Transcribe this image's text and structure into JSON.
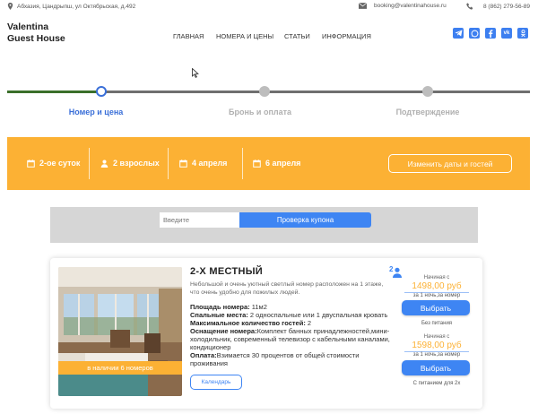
{
  "topbar": {
    "address": "Абхазия, Цандрыпш, ул Октябрьская, д.492",
    "email": "booking@valentinahouse.ru",
    "phone": "8 (862) 279-56-89"
  },
  "brand": {
    "line1": "Valentina",
    "line2": "Guest House"
  },
  "nav": [
    {
      "label": "ГЛАВНАЯ"
    },
    {
      "label": "НОМЕРА И ЦЕНЫ"
    },
    {
      "label": "СТАТЬИ"
    },
    {
      "label": "ИНФОРМАЦИЯ"
    }
  ],
  "socials": [
    {
      "icon": "telegram-icon"
    },
    {
      "icon": "whatsapp-icon"
    },
    {
      "icon": "facebook-icon"
    },
    {
      "icon": "vk-icon"
    },
    {
      "icon": "odnoklassniki-icon"
    }
  ],
  "stepper": {
    "steps": [
      {
        "label": "Номер и цена",
        "state": "active"
      },
      {
        "label": "Бронь и оплата",
        "state": "pending"
      },
      {
        "label": "Подтверждение",
        "state": "pending"
      }
    ],
    "colors": {
      "active": "#3a6fd8",
      "done_line": "#3a6f2a",
      "pending": "#bdbdbd"
    }
  },
  "summary": {
    "nights": "2-ое суток",
    "guests": "2 взрослых",
    "checkin": "4 апреля",
    "checkout": "6 апреля",
    "change_label": "Изменить даты и гостей",
    "bg_color": "#fcb134"
  },
  "coupon": {
    "placeholder": "Введите",
    "button_label": "Проверка купона"
  },
  "room": {
    "title": "2-Х МЕСТНЫЙ",
    "description": "Небольшой и очень уютный светлый номер расположен на 1 этаже, что очень удобно для пожилых людей.",
    "availability": "в наличии 6 номеров",
    "specs": [
      {
        "label": "Площадь номера:",
        "value": " 11м2"
      },
      {
        "label": "Спальные места:",
        "value": " 2 односпальные или 1 двуспальная кровать"
      },
      {
        "label": "Максимальное количество гостей:",
        "value": " 2"
      },
      {
        "label": "Оснащение номера:",
        "value": "Комплект банных принадлежностей,мини-холодильник, современный телевизор с кабельными каналами, кондиционер"
      },
      {
        "label": "Оплата:",
        "value": "Взимается 30 процентов от общей стоимости проживания"
      }
    ],
    "calendar_label": "Календарь",
    "guest_count": "2",
    "rates": [
      {
        "from": "Начиная с",
        "price": "1498,00 руб",
        "per": "за 1 ночь,за номер",
        "button": "Выбрать",
        "meal": "Без питания"
      },
      {
        "from": "Начиная с",
        "price": "1598,00 руб",
        "per": "за 1 ночь,за номер",
        "button": "Выбрать",
        "meal": "С питанием для 2х"
      }
    ]
  },
  "accent_color": "#3e85f3"
}
